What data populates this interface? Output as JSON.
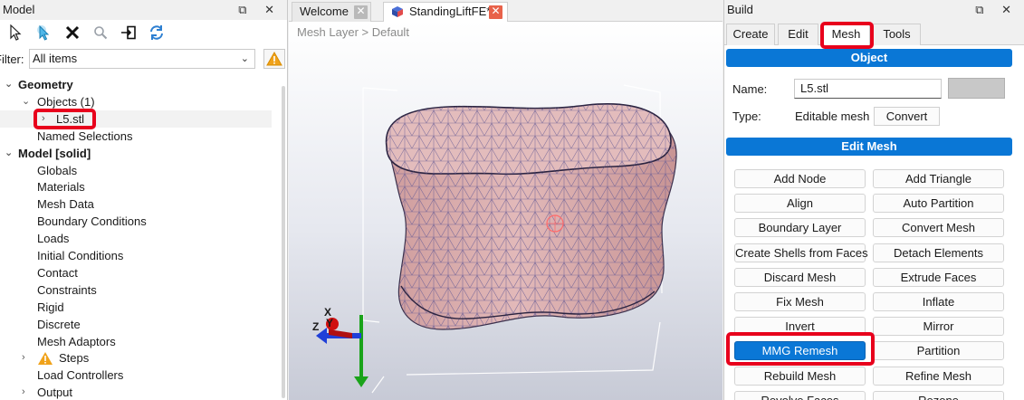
{
  "model_panel": {
    "title": "Model",
    "window_buttons": "⧉ ✕",
    "filter_label": "Filter:",
    "filter_value": "All items",
    "tree": [
      {
        "label": "Geometry",
        "level": 0,
        "bold": true,
        "arrow": "⌄"
      },
      {
        "label": "Objects (1)",
        "level": 1,
        "bold": false,
        "arrow": "⌄"
      },
      {
        "label": "L5.stl",
        "level": 2,
        "bold": false,
        "arrow": "›"
      },
      {
        "label": "Named Selections",
        "level": 1,
        "bold": false,
        "arrow": ""
      },
      {
        "label": "Model [solid]",
        "level": 0,
        "bold": true,
        "arrow": "⌄"
      },
      {
        "label": "Globals",
        "level": 1,
        "bold": false,
        "arrow": ""
      },
      {
        "label": "Materials",
        "level": 1,
        "bold": false,
        "arrow": ""
      },
      {
        "label": "Mesh Data",
        "level": 1,
        "bold": false,
        "arrow": ""
      },
      {
        "label": "Boundary Conditions",
        "level": 1,
        "bold": false,
        "arrow": ""
      },
      {
        "label": "Loads",
        "level": 1,
        "bold": false,
        "arrow": ""
      },
      {
        "label": "Initial Conditions",
        "level": 1,
        "bold": false,
        "arrow": ""
      },
      {
        "label": "Contact",
        "level": 1,
        "bold": false,
        "arrow": ""
      },
      {
        "label": "Constraints",
        "level": 1,
        "bold": false,
        "arrow": ""
      },
      {
        "label": "Rigid",
        "level": 1,
        "bold": false,
        "arrow": ""
      },
      {
        "label": "Discrete",
        "level": 1,
        "bold": false,
        "arrow": ""
      },
      {
        "label": "Mesh Adaptors",
        "level": 1,
        "bold": false,
        "arrow": ""
      },
      {
        "label": "Steps",
        "level": 1,
        "bold": false,
        "arrow": "›",
        "warning": true
      },
      {
        "label": "Load Controllers",
        "level": 1,
        "bold": false,
        "arrow": ""
      },
      {
        "label": "Output",
        "level": 1,
        "bold": false,
        "arrow": "›"
      }
    ]
  },
  "center": {
    "tabs": [
      {
        "label": "Welcome",
        "active": false
      },
      {
        "label": "StandingLiftFE*",
        "active": true
      }
    ],
    "breadcrumb": "Mesh Layer > Default",
    "axes": {
      "x": "X",
      "y": "Y",
      "z": "Z"
    }
  },
  "build_panel": {
    "title": "Build",
    "window_buttons": "⧉ ✕",
    "tabs": [
      "Create",
      "Edit",
      "Mesh",
      "Tools"
    ],
    "active_tab": "Mesh",
    "object_header": "Object",
    "name_label": "Name:",
    "name_value": "L5.stl",
    "type_label": "Type:",
    "type_value": "Editable mesh",
    "convert_label": "Convert",
    "edit_mesh_header": "Edit Mesh",
    "buttons": [
      [
        "Add Node",
        "Add Triangle"
      ],
      [
        "Align",
        "Auto Partition"
      ],
      [
        "Boundary Layer",
        "Convert Mesh"
      ],
      [
        "Create Shells from Faces",
        "Detach Elements"
      ],
      [
        "Discard Mesh",
        "Extrude Faces"
      ],
      [
        "Fix Mesh",
        "Inflate"
      ],
      [
        "Invert",
        "Mirror"
      ],
      [
        "MMG Remesh",
        "Partition"
      ],
      [
        "Rebuild Mesh",
        "Refine Mesh"
      ],
      [
        "Revolve Faces",
        "Rezone"
      ]
    ],
    "highlighted_button": "MMG Remesh"
  },
  "colors": {
    "accent_blue": "#0a77d6",
    "highlight_red": "#e8001c",
    "mesh_fill": "#d9aeae",
    "mesh_wire": "#5a4f8a"
  }
}
